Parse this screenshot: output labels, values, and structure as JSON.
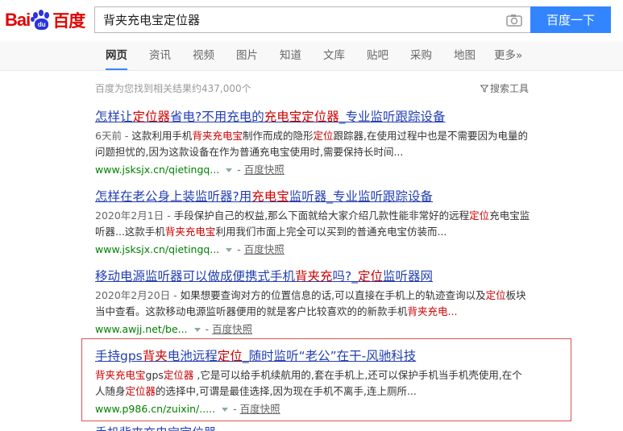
{
  "header": {
    "logo_text_left": "Bai",
    "logo_paw_text": "du",
    "logo_text_right": "百度",
    "search_value": "背夹充电宝定位器",
    "search_button": "百度一下"
  },
  "nav": {
    "items": [
      "网页",
      "资讯",
      "视频",
      "图片",
      "知道",
      "文库",
      "贴吧",
      "采购",
      "地图",
      "更多»"
    ]
  },
  "stats": {
    "result_count": "百度为您找到相关结果约437,000个",
    "search_tools": "搜索工具"
  },
  "results": [
    {
      "title": [
        {
          "t": "怎样让",
          "h": false
        },
        {
          "t": "定位器",
          "h": true
        },
        {
          "t": "省电?不用充电的",
          "h": false
        },
        {
          "t": "充电宝定位器",
          "h": true
        },
        {
          "t": "_专业监听跟踪设备",
          "h": false
        }
      ],
      "abstract": [
        {
          "t": "6天前 - ",
          "d": true
        },
        {
          "t": "这款利用手机",
          "h": false
        },
        {
          "t": "背夹充电宝",
          "h": true
        },
        {
          "t": "制作而成的隐形",
          "h": false
        },
        {
          "t": "定位",
          "h": true
        },
        {
          "t": "跟踪器,在使用过程中也是不需要因为电量的问题担忧的,因为这款设备在作为普通充电宝使用时,需要保持长时间...",
          "h": false
        }
      ],
      "url": "www.jsksjx.cn/qietingq...",
      "snapshot": "百度快照"
    },
    {
      "title": [
        {
          "t": "怎样在老公身上装监听器?用",
          "h": false
        },
        {
          "t": "充电宝",
          "h": true
        },
        {
          "t": "监听器_专业监听跟踪设备",
          "h": false
        }
      ],
      "abstract": [
        {
          "t": "2020年2月1日 - ",
          "d": true
        },
        {
          "t": "手段保护自己的权益,那么下面就给大家介绍几款性能非常好的远程",
          "h": false
        },
        {
          "t": "定位",
          "h": true
        },
        {
          "t": "充电宝监听器...这款手机",
          "h": false
        },
        {
          "t": "背夹充电宝",
          "h": true
        },
        {
          "t": "利用我们市面上完全可以买到的普通充电宝仿装而...",
          "h": false
        }
      ],
      "url": "www.jsksjx.cn/qietingq...",
      "snapshot": "百度快照"
    },
    {
      "title": [
        {
          "t": "移动电源监听器可以做成便携式手机",
          "h": false
        },
        {
          "t": "背夹充",
          "h": true
        },
        {
          "t": "吗?_",
          "h": false
        },
        {
          "t": "定位",
          "h": true
        },
        {
          "t": "监听器网",
          "h": false
        }
      ],
      "abstract": [
        {
          "t": "2020年2月20日 - ",
          "d": true
        },
        {
          "t": "如果想要查询对方的位置信息的话,可以直接在手机上的轨迹查询以及",
          "h": false
        },
        {
          "t": "定位",
          "h": true
        },
        {
          "t": "板块当中查看。这款移动电源监听器便用的就是客户比较喜欢的的新款手机",
          "h": false
        },
        {
          "t": "背夹充电...",
          "h": true
        }
      ],
      "url": "www.awjj.net/be...",
      "snapshot": "百度快照"
    },
    {
      "title": [
        {
          "t": "手持gps",
          "h": false
        },
        {
          "t": "背夹",
          "h": true
        },
        {
          "t": "电池远程",
          "h": false
        },
        {
          "t": "定位",
          "h": true
        },
        {
          "t": "_随时监听“老公”在干-风驰科技",
          "h": false
        }
      ],
      "abstract": [
        {
          "t": "背夹充电宝",
          "h": true
        },
        {
          "t": "gps",
          "h": false
        },
        {
          "t": "定位器",
          "h": true
        },
        {
          "t": " ,它是可以给手机续航用的,套在手机上,还可以保护手机当手机壳使用,在个人随身",
          "h": false
        },
        {
          "t": "定位器",
          "h": true
        },
        {
          "t": "的选择中,可谓是最佳选择,因为现在手机不离手,连上厕所...",
          "h": false
        }
      ],
      "url": "www.p986.cn/zuixin/.....",
      "snapshot": "百度快照"
    }
  ],
  "partial_next": "手机背夹充电宝定位器...",
  "colors": {
    "accent": "#3385ff",
    "title_link": "#2440b3",
    "highlight": "#c00",
    "url": "#008000",
    "box": "#d9534f"
  }
}
